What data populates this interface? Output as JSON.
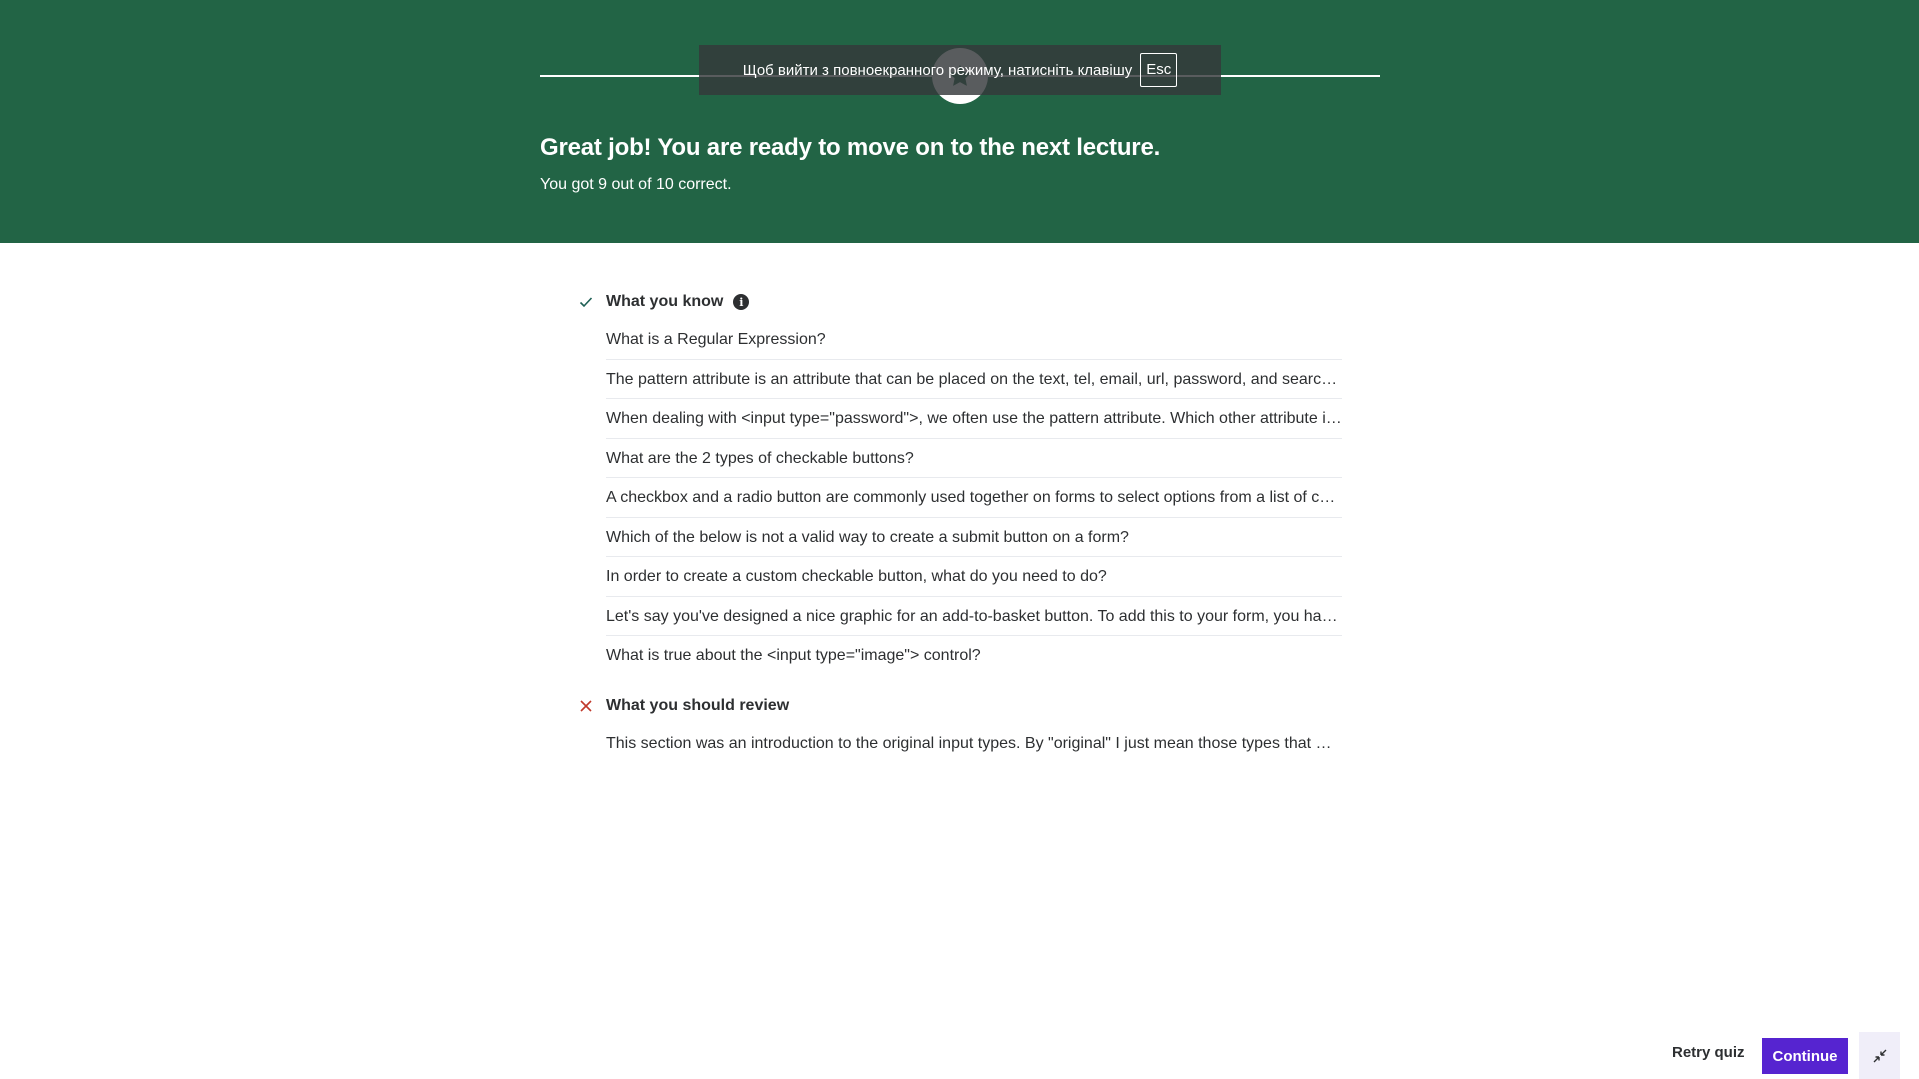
{
  "banner": {
    "title": "Great job! You are ready to move on to the next lecture.",
    "subtitle": "You got 9 out of 10 correct.",
    "badge_icon": "star-badge-icon",
    "color": "#226445"
  },
  "toast": {
    "text": "Щоб вийти з повноекранного режиму, натисніть клавішу",
    "key": "Esc"
  },
  "know": {
    "title": "What you know",
    "icon": "check-icon",
    "items": [
      "What is a Regular Expression?",
      "The pattern attribute is an attribute that can be placed on the text, tel, email, url, password, and search input types.",
      "When dealing with <input type=\"password\">, we often use the pattern attribute. Which other attribute is commonly used?",
      "What are the 2 types of checkable buttons?",
      "A checkbox and a radio button are commonly used together on forms to select options from a list of choices.",
      "Which of the below is not a valid way to create a submit button on a form?",
      "In order to create a custom checkable button, what do you need to do?",
      "Let's say you've designed a nice graphic for an add-to-basket button. To add this to your form, you have to use.",
      "What is true about the <input type=\"image\"> control?"
    ]
  },
  "review": {
    "title": "What you should review",
    "icon": "x-icon",
    "items": [
      "This section was an introduction to the original input types. By \"original\" I just mean those types that were around first."
    ]
  },
  "footer": {
    "retry_label": "Retry quiz",
    "continue_label": "Continue",
    "minimize_icon": "exit-fullscreen-icon",
    "accent": "#5624d0"
  }
}
